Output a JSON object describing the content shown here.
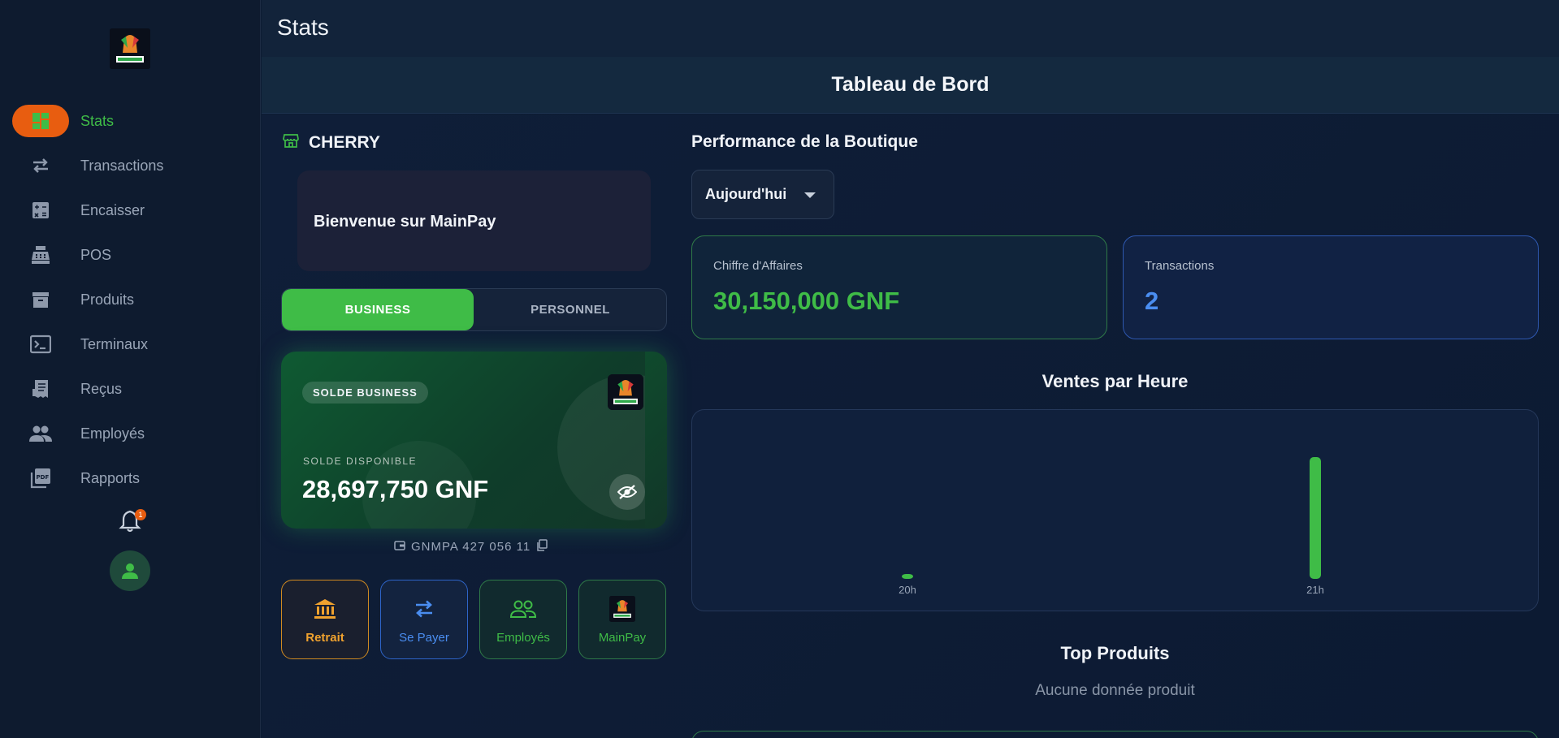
{
  "sidebar": {
    "items": [
      {
        "label": "Stats",
        "icon": "dashboard-icon",
        "active": true
      },
      {
        "label": "Transactions",
        "icon": "swap-arrows-icon",
        "active": false
      },
      {
        "label": "Encaisser",
        "icon": "calculator-icon",
        "active": false
      },
      {
        "label": "POS",
        "icon": "cash-register-icon",
        "active": false
      },
      {
        "label": "Produits",
        "icon": "archive-box-icon",
        "active": false
      },
      {
        "label": "Terminaux",
        "icon": "terminal-icon",
        "active": false
      },
      {
        "label": "Reçus",
        "icon": "receipt-icon",
        "active": false
      },
      {
        "label": "Employés",
        "icon": "people-icon",
        "active": false
      },
      {
        "label": "Rapports",
        "icon": "pdf-icon",
        "active": false
      }
    ],
    "notification_count": "1"
  },
  "header": {
    "title": "Stats",
    "subtitle": "Tableau de Bord"
  },
  "shop": {
    "name": "CHERRY",
    "welcome": "Bienvenue sur MainPay"
  },
  "account_toggle": {
    "business": "BUSINESS",
    "personal": "PERSONNEL",
    "selected": "BUSINESS"
  },
  "balance_card": {
    "badge": "SOLDE BUSINESS",
    "label": "SOLDE DISPONIBLE",
    "amount": "28,697,750 GNF",
    "account_number": "GNMPA 427 056 11"
  },
  "actions": {
    "retrait": "Retrait",
    "se_payer": "Se Payer",
    "employes": "Employés",
    "mainpay": "MainPay"
  },
  "performance": {
    "title": "Performance de la Boutique",
    "period": "Aujourd'hui",
    "revenue_label": "Chiffre d'Affaires",
    "revenue_value": "30,150,000 GNF",
    "transactions_label": "Transactions",
    "transactions_value": "2"
  },
  "sales_chart_title": "Ventes par Heure",
  "chart_data": {
    "type": "bar",
    "title": "Ventes par Heure",
    "categories": [
      "20h",
      "21h"
    ],
    "values": [
      150000,
      30000000
    ],
    "xlabel": "",
    "ylabel": "",
    "ylim": [
      0,
      30000000
    ],
    "grid": false,
    "color": "#3fbc47"
  },
  "top_products": {
    "title": "Top Produits",
    "empty": "Aucune donnée produit"
  },
  "colors": {
    "accent_green": "#3fbc47",
    "accent_orange": "#e85d10",
    "accent_blue": "#4a8df0"
  }
}
